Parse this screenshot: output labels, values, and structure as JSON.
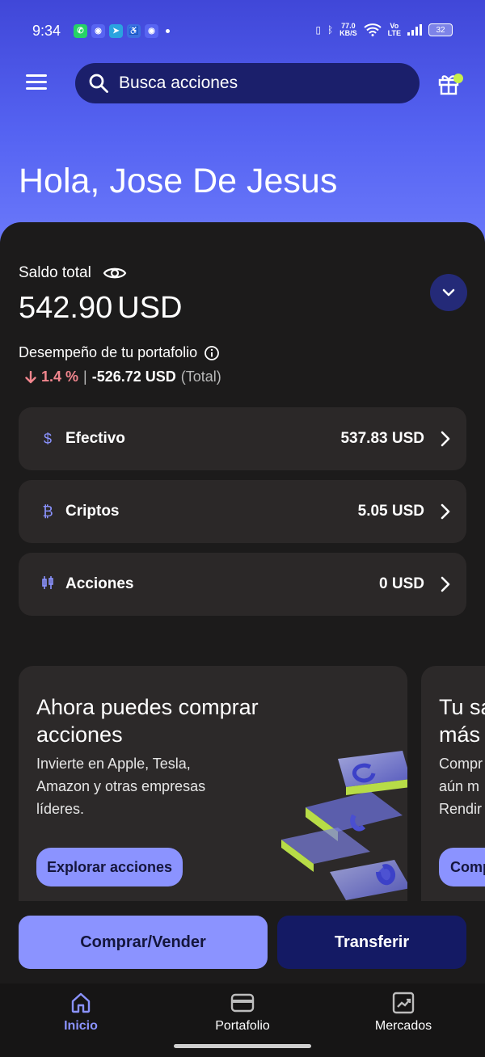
{
  "status_bar": {
    "time": "9:34",
    "notification_icons": [
      "whatsapp-icon",
      "discord-icon",
      "telegram-icon",
      "accessibility-icon",
      "discord-icon"
    ],
    "network_speed": "77.0",
    "network_speed_unit": "KB/S",
    "volte_top": "Vo",
    "volte_bottom": "LTE",
    "battery": "32"
  },
  "header": {
    "search_prefix": "Busca",
    "search_text": "acciones"
  },
  "greeting": "Hola, Jose De Jesus",
  "balance": {
    "label": "Saldo total",
    "amount": "542.90",
    "currency": "USD"
  },
  "performance": {
    "label": "Desempeño de tu portafolio",
    "percent": "1.4 %",
    "separator": "|",
    "amount": "-526.72 USD",
    "period": "(Total)"
  },
  "accounts": [
    {
      "icon": "$",
      "label": "Efectivo",
      "value": "537.83 USD"
    },
    {
      "icon": "₿",
      "label": "Criptos",
      "value": "5.05 USD"
    },
    {
      "icon": "0¢",
      "label": "Acciones",
      "value": "0 USD"
    }
  ],
  "promo": {
    "title": "Ahora puedes comprar acciones",
    "body": "Invierte en Apple, Tesla, Amazon y otras empresas líderes.",
    "button": "Explorar acciones"
  },
  "promo2": {
    "title_line1": "Tu sa",
    "title_line2": "más",
    "body_line1": "Compr",
    "body_line2": "aún m",
    "body_line3": "Rendir",
    "button": "Comp"
  },
  "actions": {
    "buy_sell": "Comprar/Vender",
    "transfer": "Transferir"
  },
  "bottom_nav": [
    {
      "label": "Inicio",
      "active": true
    },
    {
      "label": "Portafolio",
      "active": false
    },
    {
      "label": "Mercados",
      "active": false
    }
  ],
  "colors": {
    "accent": "#8b93ff",
    "hero": "#5563f2",
    "negative": "#f2868e",
    "surface": "#2b2828"
  }
}
